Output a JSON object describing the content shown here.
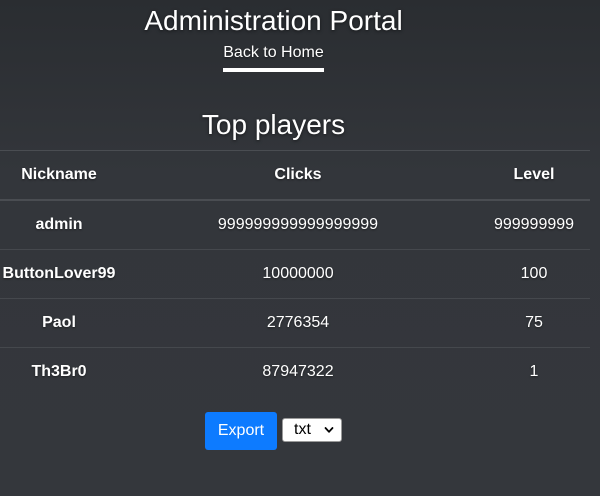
{
  "header": {
    "title": "Administration Portal",
    "home_link": "Back to Home"
  },
  "section": {
    "title": "Top players"
  },
  "table": {
    "columns": [
      "Nickname",
      "Clicks",
      "Level"
    ],
    "rows": [
      {
        "nickname": "admin",
        "clicks": "999999999999999999",
        "level": "999999999"
      },
      {
        "nickname": "ButtonLover99",
        "clicks": "10000000",
        "level": "100"
      },
      {
        "nickname": "Paol",
        "clicks": "2776354",
        "level": "75"
      },
      {
        "nickname": "Th3Br0",
        "clicks": "87947322",
        "level": "1"
      }
    ]
  },
  "export": {
    "button_label": "Export",
    "format_selected": "txt",
    "chevron_icon": "chevron-down-icon"
  },
  "colors": {
    "accent": "#0d7bff",
    "background": "#34373c"
  }
}
